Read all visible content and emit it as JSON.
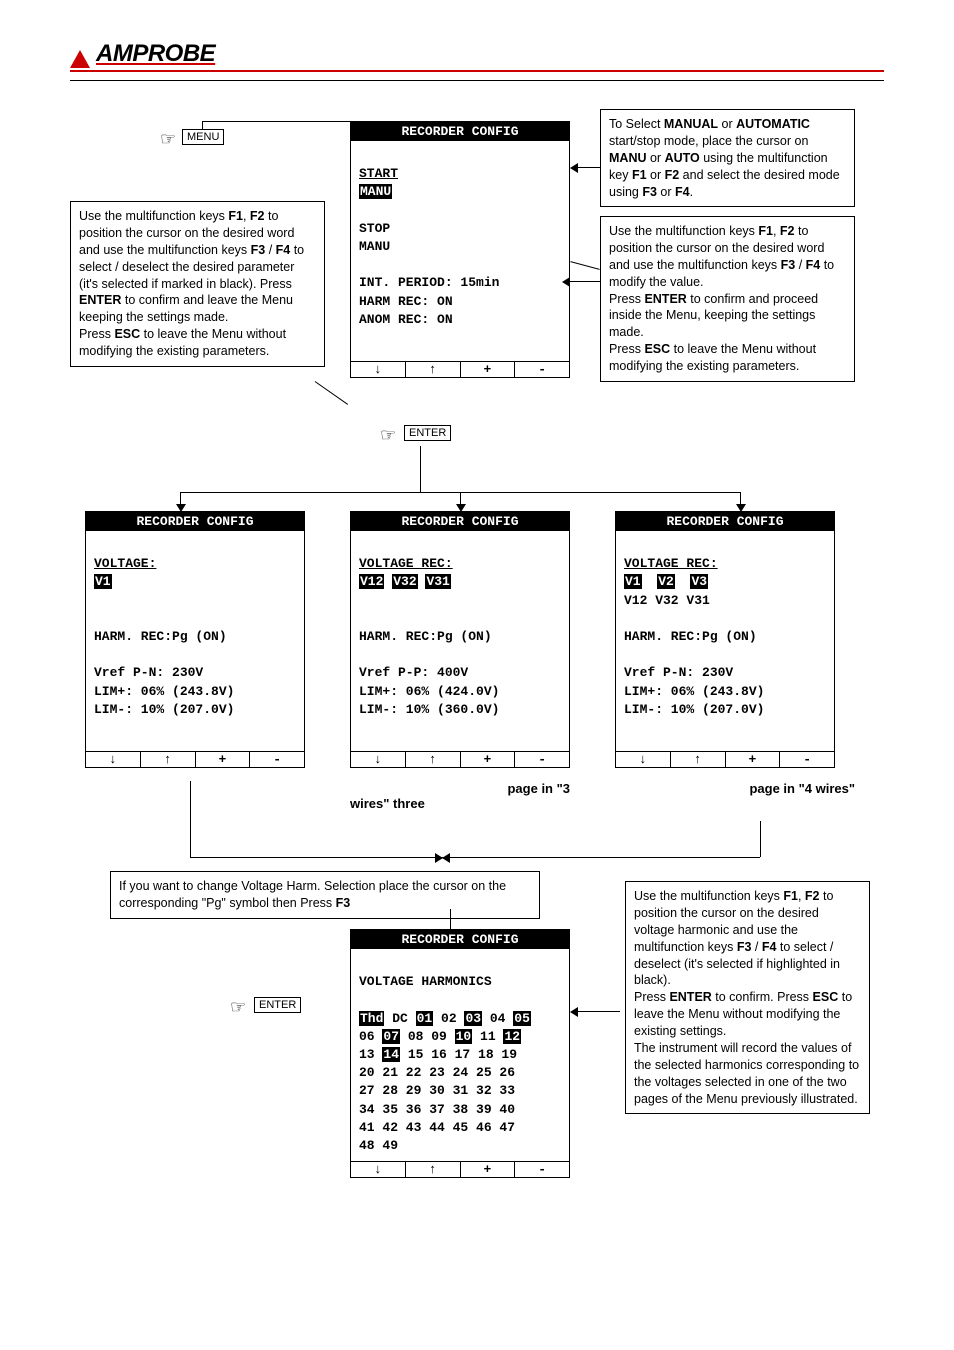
{
  "brand": "AMPROBE",
  "keys": {
    "menu": "MENU",
    "enter": "ENTER"
  },
  "boxes": {
    "upper_left": "Use the multifunction keys <b>F1</b>, <b>F2</b> to position the cursor on the desired word and use the multifunction keys <b>F3</b> / <b>F4</b> to select / deselect the desired parameter (it's selected if marked in black). Press <b>ENTER</b> to confirm and leave the Menu keeping the settings made.<br>Press <b>ESC</b> to leave the Menu without modifying the existing parameters.",
    "upper_right_a": "To Select <b>MANUAL</b> or <b>AUTOMATIC</b> start/stop mode, place the cursor on <b>MANU</b> or <b>AUTO</b> using the multifunction key <b>F1</b> or <b>F2</b> and select the desired mode using <b>F3</b> or <b>F4</b>.",
    "upper_right_b": "Use the multifunction keys <b>F1</b>, <b>F2</b> to position the cursor on the desired word and use the multifunction keys <b>F3</b> / <b>F4</b> to modify the value.<br>Press <b>ENTER</b> to confirm and proceed inside the Menu, keeping the settings made.<br>Press <b>ESC</b> to leave the Menu without modifying the existing parameters.",
    "mid_note": "If you want to change Voltage Harm. Selection place the cursor on the corresponding \"Pg\" symbol then Press <b>F3</b>",
    "lower_right": "Use the multifunction keys <b>F1</b>, <b>F2</b> to position the cursor on the desired voltage harmonic and use the multifunction keys <b>F3</b> / <b>F4</b> to select / deselect (it's selected if highlighted in black).<br>Press <b>ENTER</b> to confirm. Press <b>ESC</b> to leave the Menu without modifying the existing settings.<br>The instrument will record the values of the selected harmonics corresponding to the voltages selected in one of the two pages of the Menu previously illustrated."
  },
  "lcd_title": "RECORDER CONFIG",
  "fkeys": {
    "f1": "↓",
    "f2": "↑",
    "f3": "+",
    "f4": "-"
  },
  "captions": {
    "three_wires": "page in \"3 wires\" three",
    "four_wires": "page in \"4 wires\""
  },
  "screens": {
    "main": {
      "start_label": "START",
      "start_mode": "MANU",
      "stop_label": "STOP",
      "stop_mode": "MANU",
      "int_period": "INT. PERIOD: 15min",
      "harm_rec": "HARM REC: ON",
      "anom_rec": "ANOM REC: ON"
    },
    "voltage_v1": {
      "voltage_label": "VOLTAGE:",
      "sel": "V1",
      "harm": "HARM. REC:Pg (ON)",
      "vref": "Vref P-N: 230V",
      "limp": "LIM+: 06% (243.8V)",
      "limm": "LIM-: 10% (207.0V)"
    },
    "voltage_3w": {
      "voltage_label": "VOLTAGE REC:",
      "sel": [
        "V12",
        "V32",
        "V31"
      ],
      "harm": "HARM. REC:Pg (ON)",
      "vref": "Vref P-P: 400V",
      "limp": "LIM+: 06% (424.0V)",
      "limm": "LIM-: 10% (360.0V)"
    },
    "voltage_4w": {
      "voltage_label": "VOLTAGE REC:",
      "sel_top": [
        "V1",
        "V2",
        "V3"
      ],
      "sel_bot": [
        "V12",
        "V32",
        "V31"
      ],
      "harm": "HARM. REC:Pg (ON)",
      "vref": "Vref P-N: 230V",
      "limp": "LIM+: 06% (243.8V)",
      "limm": "LIM-: 10% (207.0V)"
    },
    "harmonics": {
      "title": "VOLTAGE HARMONICS",
      "cells": [
        "Thd",
        "DC",
        "01",
        "02",
        "03",
        "04",
        "05",
        "06",
        "07",
        "08",
        "09",
        "10",
        "11",
        "12",
        "13",
        "14",
        "15",
        "16",
        "17",
        "18",
        "19",
        "20",
        "21",
        "22",
        "23",
        "24",
        "25",
        "26",
        "27",
        "28",
        "29",
        "30",
        "31",
        "32",
        "33",
        "34",
        "35",
        "36",
        "37",
        "38",
        "39",
        "40",
        "41",
        "42",
        "43",
        "44",
        "45",
        "46",
        "47",
        "48",
        "49"
      ],
      "selected": [
        "Thd",
        "01",
        "03",
        "05",
        "07",
        "10",
        "12",
        "14"
      ]
    }
  }
}
